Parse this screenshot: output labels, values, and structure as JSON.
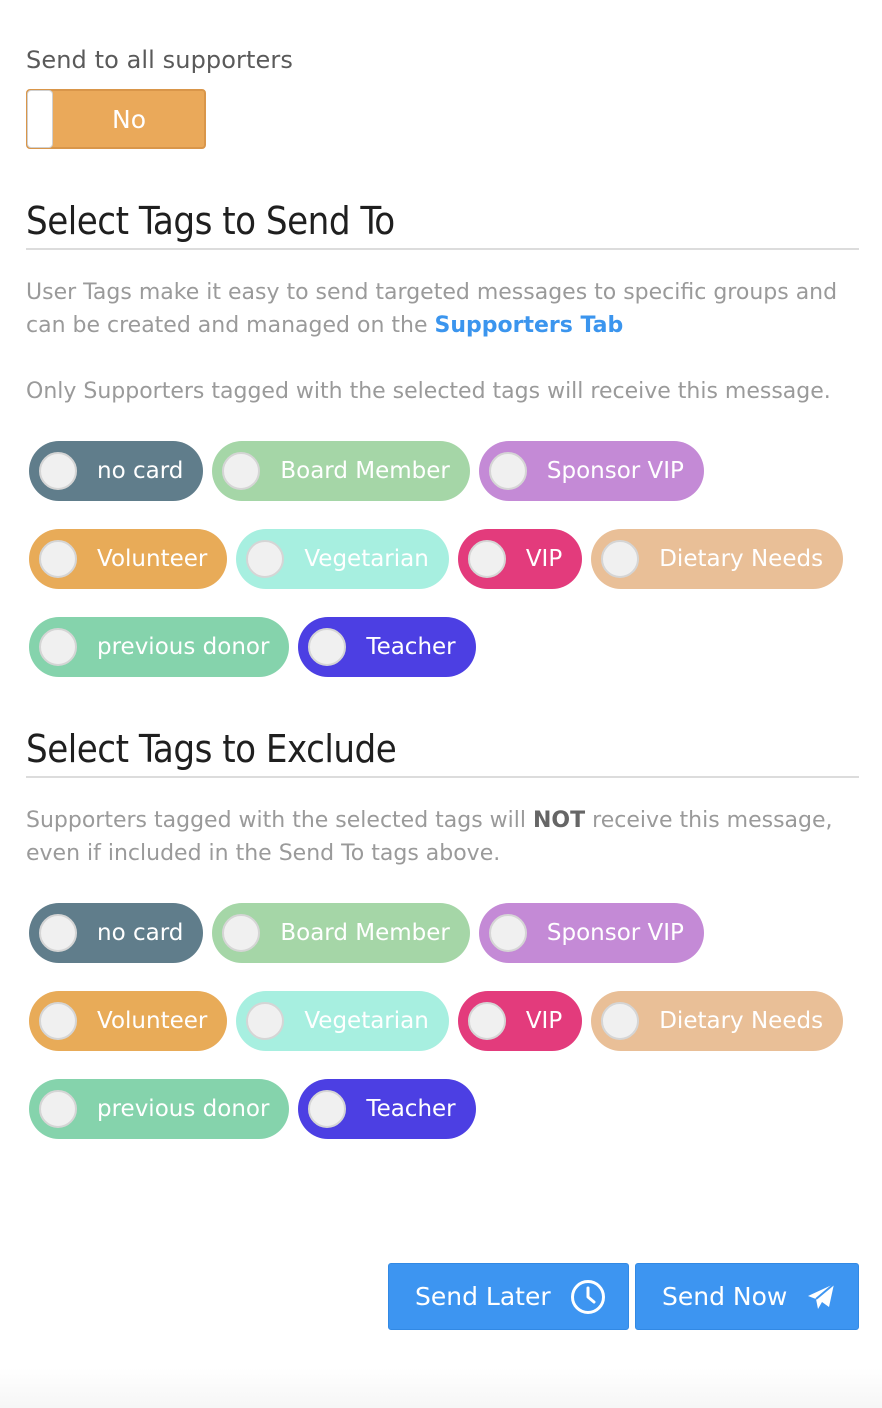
{
  "send_all": {
    "label": "Send to all supporters",
    "toggle_value": "No"
  },
  "send_to": {
    "title": "Select Tags to Send To",
    "desc_part1": "User Tags make it easy to send targeted messages to specific groups and can be created and managed on the ",
    "desc_link": "Supporters Tab",
    "note": "Only Supporters tagged with the selected tags will receive this message.",
    "tags": [
      {
        "label": "no card",
        "color": "#607d8b"
      },
      {
        "label": "Board Member",
        "color": "#a5d6a7"
      },
      {
        "label": "Sponsor VIP",
        "color": "#c48ad6"
      },
      {
        "label": "Volunteer",
        "color": "#e8ab58"
      },
      {
        "label": "Vegetarian",
        "color": "#a7efe0"
      },
      {
        "label": "VIP",
        "color": "#e33b7c"
      },
      {
        "label": "Dietary Needs",
        "color": "#e9bf97"
      },
      {
        "label": "previous donor",
        "color": "#85d3ac"
      },
      {
        "label": "Teacher",
        "color": "#4c3fe3"
      }
    ]
  },
  "exclude": {
    "title": "Select Tags to Exclude",
    "desc_a": "Supporters tagged with the selected tags will ",
    "desc_bold": "NOT",
    "desc_b": " receive this message, even if included in the Send To tags above.",
    "tags": [
      {
        "label": "no card",
        "color": "#607d8b"
      },
      {
        "label": "Board Member",
        "color": "#a5d6a7"
      },
      {
        "label": "Sponsor VIP",
        "color": "#c48ad6"
      },
      {
        "label": "Volunteer",
        "color": "#e8ab58"
      },
      {
        "label": "Vegetarian",
        "color": "#a7efe0"
      },
      {
        "label": "VIP",
        "color": "#e33b7c"
      },
      {
        "label": "Dietary Needs",
        "color": "#e9bf97"
      },
      {
        "label": "previous donor",
        "color": "#85d3ac"
      },
      {
        "label": "Teacher",
        "color": "#4c3fe3"
      }
    ]
  },
  "actions": {
    "send_later": {
      "label": "Send Later",
      "icon": "clock-icon"
    },
    "send_now": {
      "label": "Send Now",
      "icon": "paper-plane-icon"
    }
  },
  "colors": {
    "toggle_off": "#eaa95a",
    "primary_button": "#3d95f1",
    "link": "#3b95ee"
  }
}
